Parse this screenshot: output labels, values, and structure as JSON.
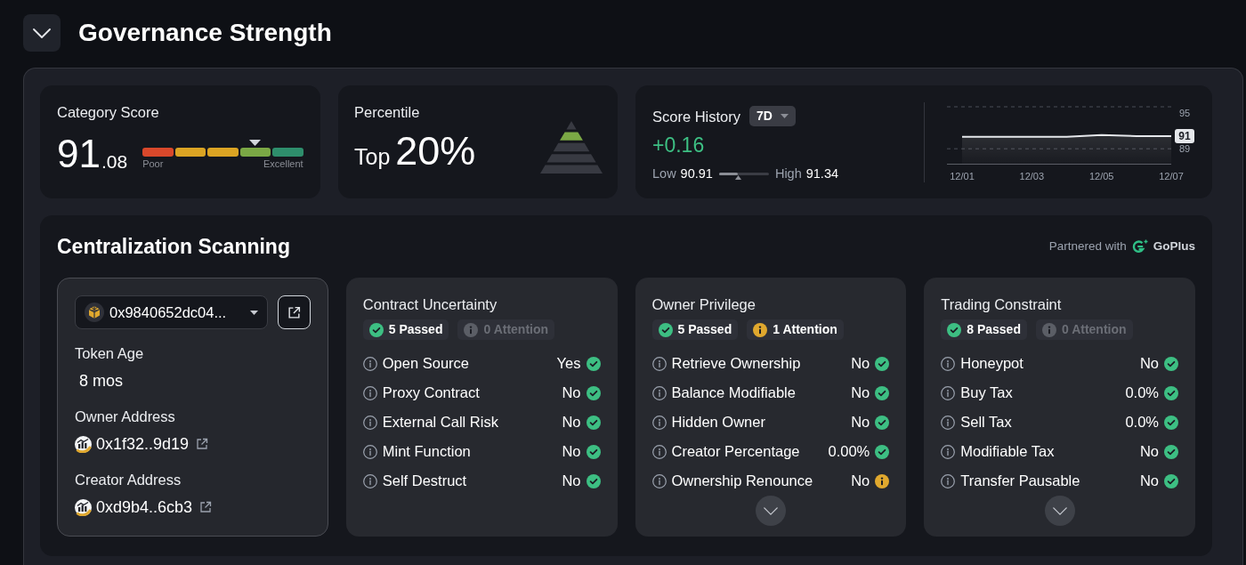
{
  "header": {
    "title": "Governance Strength",
    "expanded": true
  },
  "scores": {
    "category_score": {
      "title": "Category Score",
      "value": "91",
      "decimals": ".08",
      "segments": [
        {
          "color": "#d9482b",
          "selected": false
        },
        {
          "color": "#dba423",
          "selected": false
        },
        {
          "color": "#dba423",
          "selected": false
        },
        {
          "color": "#7ba845",
          "selected": true
        },
        {
          "color": "#2e8e6c",
          "selected": false
        }
      ],
      "low_label": "Poor",
      "high_label": "Excellent"
    },
    "percentile": {
      "title": "Percentile",
      "prefix": "Top",
      "value": "20%",
      "tiers": [
        {
          "selected": false
        },
        {
          "selected": true
        },
        {
          "selected": false
        },
        {
          "selected": false
        },
        {
          "selected": false
        }
      ]
    },
    "score_history": {
      "title": "Score History",
      "period": "7D",
      "change": "+0.16",
      "low_label": "Low",
      "low": "90.91",
      "high_label": "High",
      "high": "91.34",
      "range": {
        "level": 0.38
      },
      "chart_data": {
        "type": "area",
        "categories": [
          "12/01",
          null,
          "12/03",
          null,
          "12/05",
          null,
          "12/07"
        ],
        "series": [
          {
            "color": "#e5e7eb",
            "values": [
              91.0,
              91.0,
              91.0,
              91.0,
              91.3,
              91.1,
              91.1
            ]
          }
        ],
        "ylim": [
          86.5,
          96
        ],
        "yticks": [
          89,
          95
        ],
        "annotations": [
          "91"
        ]
      }
    }
  },
  "centralization": {
    "title": "Centralization Scanning",
    "partner_label": "Partnered with",
    "partner_name": "GoPlus",
    "token": {
      "address": "0x9840652dc04...",
      "fields": [
        {
          "kind": "text",
          "label": "Token Age",
          "value": "8 mos"
        },
        {
          "kind": "address",
          "label": "Owner Address",
          "value": "0x1f32..9d19"
        },
        {
          "kind": "address",
          "label": "Creator Address",
          "value": "0xd9b4..6cb3"
        }
      ]
    },
    "groups": [
      {
        "title": "Contract Uncertainty",
        "badges": [
          {
            "kind": "passed",
            "label": "5 Passed",
            "muted": false
          },
          {
            "kind": "attention",
            "label": "0 Attention",
            "muted": true
          }
        ],
        "checks": [
          {
            "label": "Open Source",
            "value": "Yes",
            "passed": true
          },
          {
            "label": "Proxy Contract",
            "value": "No",
            "passed": true
          },
          {
            "label": "External Call Risk",
            "value": "No",
            "passed": true
          },
          {
            "label": "Mint Function",
            "value": "No",
            "passed": true
          },
          {
            "label": "Self Destruct",
            "value": "No",
            "passed": true
          }
        ],
        "show_more": false
      },
      {
        "title": "Owner Privilege",
        "badges": [
          {
            "kind": "passed",
            "label": "5 Passed",
            "muted": false
          },
          {
            "kind": "attention",
            "label": "1 Attention",
            "muted": false
          }
        ],
        "checks": [
          {
            "label": "Retrieve Ownership",
            "value": "No",
            "passed": true
          },
          {
            "label": "Balance Modifiable",
            "value": "No",
            "passed": true
          },
          {
            "label": "Hidden Owner",
            "value": "No",
            "passed": true
          },
          {
            "label": "Creator Percentage",
            "value": "0.00%",
            "passed": true
          },
          {
            "label": "Ownership Renounce",
            "value": "No",
            "passed": false
          }
        ],
        "show_more": true
      },
      {
        "title": "Trading Constraint",
        "badges": [
          {
            "kind": "passed",
            "label": "8 Passed",
            "muted": false
          },
          {
            "kind": "attention",
            "label": "0 Attention",
            "muted": true
          }
        ],
        "checks": [
          {
            "label": "Honeypot",
            "value": "No",
            "passed": true
          },
          {
            "label": "Buy Tax",
            "value": "0.0%",
            "passed": true
          },
          {
            "label": "Sell Tax",
            "value": "0.0%",
            "passed": true
          },
          {
            "label": "Modifiable Tax",
            "value": "No",
            "passed": true
          },
          {
            "label": "Transfer Pausable",
            "value": "No",
            "passed": true
          }
        ],
        "show_more": true
      }
    ]
  }
}
